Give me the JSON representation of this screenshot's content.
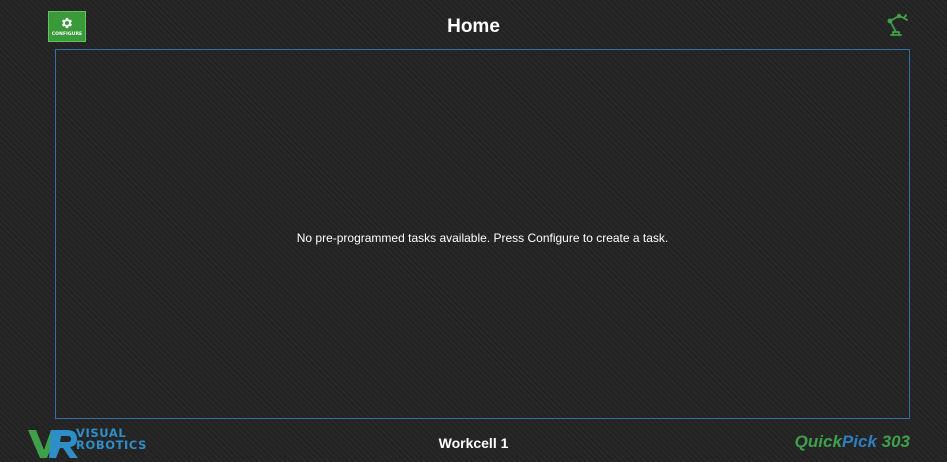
{
  "header": {
    "title": "Home",
    "configure_label": "CONFIGURE",
    "configure_icon": "gear-icon",
    "robot_icon": "robot-arm-icon"
  },
  "main": {
    "empty_message": "No pre-programmed tasks available. Press Configure to create a task."
  },
  "footer": {
    "logo_line1": "VISUAL",
    "logo_line2": "ROBOTICS",
    "workcell": "Workcell 1",
    "brand_quick": "Quick",
    "brand_pick": "Pick",
    "brand_number": " 303"
  },
  "colors": {
    "background": "#232323",
    "accent_green": "#3fa04a",
    "accent_blue": "#2c7fc1",
    "panel_border": "#2f6fb0",
    "configure_button": "#3a9a3a"
  }
}
